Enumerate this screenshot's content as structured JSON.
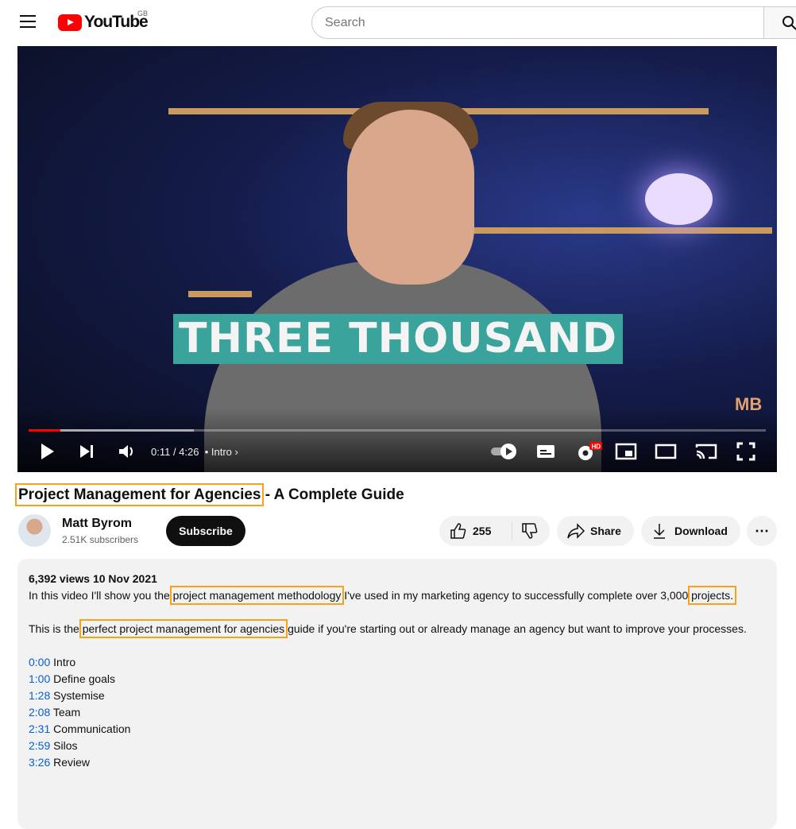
{
  "header": {
    "logo_text": "YouTube",
    "region": "GB",
    "search_placeholder": "Search"
  },
  "player": {
    "overlay_text": "THREE THOUSAND",
    "watermark": "MB",
    "time": "0:11 / 4:26",
    "chapter": "• Intro",
    "progress_percent": 4.3,
    "buffered_percent": 22.4,
    "quality_badge": "HD"
  },
  "video": {
    "title_highlight": "Project Management for Agencies",
    "title_rest": " - A Complete Guide"
  },
  "channel": {
    "name": "Matt Byrom",
    "subscribers": "2.51K subscribers",
    "subscribe_label": "Subscribe"
  },
  "actions": {
    "likes": "255",
    "share": "Share",
    "download": "Download"
  },
  "description": {
    "meta": "6,392 views  10 Nov 2021",
    "p1_a": "In this video I'll show you the ",
    "p1_hl1": "project management methodology",
    "p1_b": " I've used in my marketing agency to successfully complete over 3,000 ",
    "p1_hl2": "projects.",
    "p2_a": "This is the ",
    "p2_hl": "perfect project management for agencies",
    "p2_b": " guide if you're starting out or already manage an agency but want to improve your processes.",
    "chapters": [
      {
        "time": "0:00",
        "label": " Intro"
      },
      {
        "time": "1:00",
        "label": " Define goals"
      },
      {
        "time": "1:28",
        "label": " Systemise"
      },
      {
        "time": "2:08",
        "label": " Team"
      },
      {
        "time": "2:31",
        "label": " Communication"
      },
      {
        "time": "2:59",
        "label": " Silos"
      },
      {
        "time": "3:26",
        "label": " Review"
      }
    ]
  },
  "colors": {
    "brand": "#ff0000",
    "highlight": "#f7a21b",
    "link": "#065fd4",
    "banner": "#3aa39c"
  }
}
